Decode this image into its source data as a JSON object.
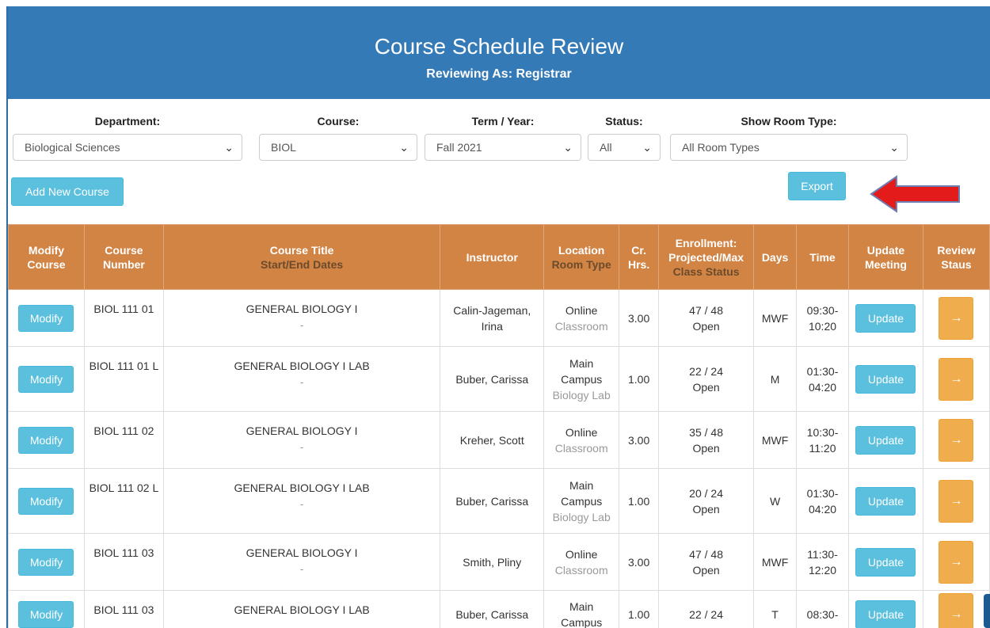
{
  "header": {
    "title": "Course Schedule Review",
    "subtitle": "Reviewing As: Registrar"
  },
  "filters": {
    "department": {
      "label": "Department:",
      "value": "Biological Sciences"
    },
    "course": {
      "label": "Course:",
      "value": "BIOL"
    },
    "term": {
      "label": "Term / Year:",
      "value": "Fall 2021"
    },
    "status": {
      "label": "Status:",
      "value": "All"
    },
    "room_type": {
      "label": "Show Room Type:",
      "value": "All Room Types"
    }
  },
  "actions": {
    "add_course": "Add New Course",
    "export": "Export"
  },
  "table": {
    "headers": {
      "modify": [
        "Modify",
        "Course"
      ],
      "number": [
        "Course",
        "Number"
      ],
      "title": [
        "Course Title",
        "Start/End Dates"
      ],
      "instructor": "Instructor",
      "location": [
        "Location",
        "Room Type"
      ],
      "credit": [
        "Cr.",
        "Hrs."
      ],
      "enrollment": [
        "Enrollment:",
        "Projected/Max",
        "Class Status"
      ],
      "days": "Days",
      "time": "Time",
      "update": [
        "Update",
        "Meeting"
      ],
      "review": [
        "Review",
        "Staus"
      ]
    },
    "modify_label": "Modify",
    "update_label": "Update",
    "review_icon": "→",
    "rows": [
      {
        "number": "BIOL 111 01",
        "title": "GENERAL BIOLOGY I",
        "dates": "-",
        "instructor": "Calin-Jageman, Irina",
        "location": "Online",
        "room_type": "Classroom",
        "credits": "3.00",
        "enrollment": "47 / 48",
        "status": "Open",
        "days": "MWF",
        "time_start": "09:30-",
        "time_end": "10:20"
      },
      {
        "number": "BIOL 111 01 L",
        "title": "GENERAL BIOLOGY I LAB",
        "dates": "-",
        "instructor": "Buber, Carissa",
        "location": "Main Campus",
        "room_type": "Biology Lab",
        "credits": "1.00",
        "enrollment": "22 / 24",
        "status": "Open",
        "days": "M",
        "time_start": "01:30-",
        "time_end": "04:20"
      },
      {
        "number": "BIOL 111 02",
        "title": "GENERAL BIOLOGY I",
        "dates": "-",
        "instructor": "Kreher, Scott",
        "location": "Online",
        "room_type": "Classroom",
        "credits": "3.00",
        "enrollment": "35 / 48",
        "status": "Open",
        "days": "MWF",
        "time_start": "10:30-",
        "time_end": "11:20"
      },
      {
        "number": "BIOL 111 02 L",
        "title": "GENERAL BIOLOGY I LAB",
        "dates": "-",
        "instructor": "Buber, Carissa",
        "location": "Main Campus",
        "room_type": "Biology Lab",
        "credits": "1.00",
        "enrollment": "20 / 24",
        "status": "Open",
        "days": "W",
        "time_start": "01:30-",
        "time_end": "04:20"
      },
      {
        "number": "BIOL 111 03",
        "title": "GENERAL BIOLOGY I",
        "dates": "-",
        "instructor": "Smith, Pliny",
        "location": "Online",
        "room_type": "Classroom",
        "credits": "3.00",
        "enrollment": "47 / 48",
        "status": "Open",
        "days": "MWF",
        "time_start": "11:30-",
        "time_end": "12:20"
      },
      {
        "number": "BIOL 111 03",
        "title": "GENERAL BIOLOGY I LAB",
        "dates": "",
        "instructor": "Buber, Carissa",
        "location": "Main Campus",
        "room_type": "",
        "credits": "1.00",
        "enrollment": "22 / 24",
        "status": "",
        "days": "T",
        "time_start": "08:30-",
        "time_end": ""
      }
    ]
  },
  "colors": {
    "banner": "#337ab7",
    "table_header": "#d28445",
    "info_button": "#5bc0de",
    "review_button": "#f0ad4e",
    "annotation_arrow": "#e31b1b"
  }
}
